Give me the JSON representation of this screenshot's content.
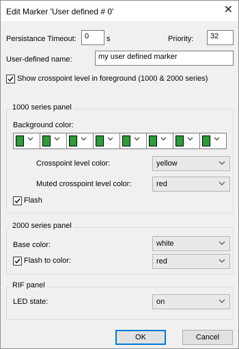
{
  "window": {
    "title": "Edit Marker 'User defined # 0'",
    "close_glyph": "✕"
  },
  "top": {
    "persistance_label": "Persistance Timeout:",
    "persistance_value": "0",
    "persistance_unit": "s",
    "priority_label": "Priority:",
    "priority_value": "32",
    "user_name_label": "User-defined name:",
    "user_name_value": "my user defined marker",
    "show_crosspoint_label": "Show crosspoint level in foreground (1000 & 2000 series)",
    "show_crosspoint_checked": true
  },
  "panel_1000": {
    "title": "1000 series panel",
    "background_color_label": "Background color:",
    "color_swatches": [
      "#2e9b3a",
      "#2e9b3a",
      "#2e9b3a",
      "#2e9b3a",
      "#2e9b3a",
      "#2e9b3a",
      "#2e9b3a",
      "#2e9b3a"
    ],
    "crosspoint_level_label": "Crosspoint level color:",
    "crosspoint_level_value": "yellow",
    "muted_level_label": "Muted crosspoint level color:",
    "muted_level_value": "red",
    "flash_label": "Flash",
    "flash_checked": true
  },
  "panel_2000": {
    "title": "2000 series panel",
    "base_color_label": "Base color:",
    "base_color_value": "white",
    "flash_to_label": "Flash to color:",
    "flash_to_value": "red",
    "flash_to_checked": true
  },
  "rif": {
    "title": "RIF panel",
    "led_state_label": "LED state:",
    "led_state_value": "on"
  },
  "buttons": {
    "ok": "OK",
    "cancel": "Cancel"
  }
}
